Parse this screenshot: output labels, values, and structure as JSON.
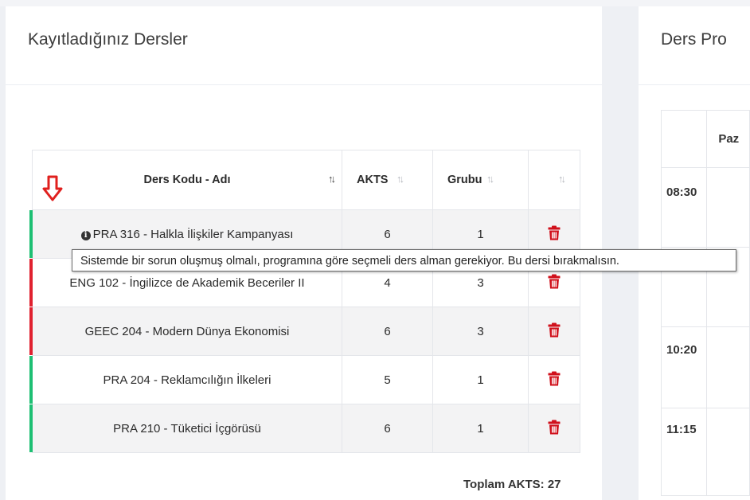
{
  "left_card": {
    "title": "Kayıtladığınız Dersler",
    "headers": {
      "course": "Ders Kodu - Adı",
      "akts": "AKTS",
      "group": "Grubu",
      "sort_glyph": "↑↓"
    },
    "rows": [
      {
        "course": "PRA 316 - Halkla İlişkiler Kampanyası",
        "akts": "6",
        "group": "1",
        "status": "green",
        "has_info": true
      },
      {
        "course": "ENG 102 - İngilizce de Akademik Beceriler II",
        "akts": "4",
        "group": "3",
        "status": "red",
        "has_info": false
      },
      {
        "course": "GEEC 204 - Modern Dünya Ekonomisi",
        "akts": "6",
        "group": "3",
        "status": "red",
        "has_info": false
      },
      {
        "course": "PRA 204 - Reklamcılığın İlkeleri",
        "akts": "5",
        "group": "1",
        "status": "green",
        "has_info": false
      },
      {
        "course": "PRA 210 - Tüketici İçgörüsü",
        "akts": "6",
        "group": "1",
        "status": "green",
        "has_info": false
      }
    ],
    "total": "Toplam AKTS: 27"
  },
  "tooltip": "Sistemde bir sorun oluşmuş olmalı, programına göre seçmeli ders alman gerekiyor. Bu dersi bırakmalısın.",
  "right_card": {
    "title": "Ders Pro",
    "day_header": "Paz",
    "times": [
      "08:30",
      "",
      "10:20",
      "11:15"
    ]
  },
  "colors": {
    "green": "#1dbf73",
    "red": "#e0212f",
    "trash": "#d0101b",
    "arrow": "#e0201e"
  },
  "icons": {
    "info": "info-circle-icon",
    "delete": "trash-icon",
    "annotation": "down-arrow-icon"
  }
}
